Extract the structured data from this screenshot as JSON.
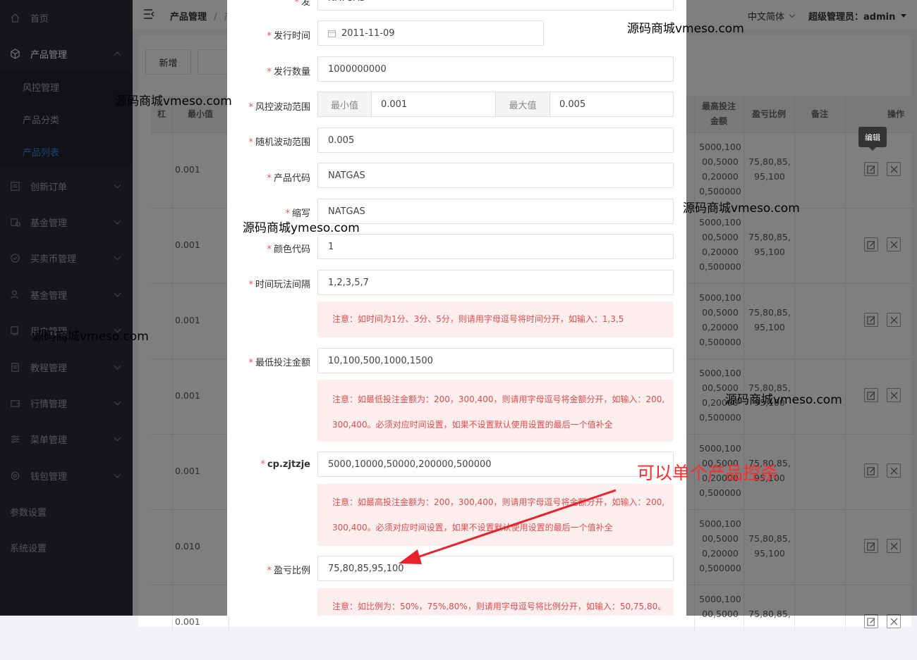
{
  "sidebar": {
    "items": [
      {
        "label": "首页",
        "icon": "home-icon"
      },
      {
        "label": "产品管理",
        "icon": "cube-icon"
      },
      {
        "label": "创新订单",
        "icon": "list-icon"
      },
      {
        "label": "基金管理",
        "icon": "coins-icon"
      },
      {
        "label": "买卖币管理",
        "icon": "check-circle-icon"
      },
      {
        "label": "基金管理",
        "icon": "user-icon"
      },
      {
        "label": "用户管理",
        "icon": "monitor-icon"
      },
      {
        "label": "教程管理",
        "icon": "doc-icon"
      },
      {
        "label": "行情管理",
        "icon": "wallet-icon"
      },
      {
        "label": "菜单管理",
        "icon": "sliders-icon"
      },
      {
        "label": "钱包管理",
        "icon": "gear-icon"
      },
      {
        "label": "参数设置",
        "icon": ""
      },
      {
        "label": "系统设置",
        "icon": ""
      }
    ],
    "submenu": [
      "风控管理",
      "产品分类",
      "产品列表"
    ]
  },
  "topbar": {
    "breadcrumb_1": "产品管理",
    "breadcrumb_sep": "/",
    "breadcrumb_2": "产",
    "language": "中文简体",
    "user": "超级管理员：admin"
  },
  "toolbar": {
    "add_label": "新增"
  },
  "table": {
    "headers": {
      "col1": "杠",
      "col2": "最小值",
      "max_bet": "最高投注金额",
      "profit_ratio": "盈亏比例",
      "remark": "备注",
      "ops": "操作"
    },
    "rows": [
      {
        "min": "0.001",
        "max_bet": "5000,100\n00,5000\n0,20000\n0,500000",
        "ratio": "75,80,85,\n95,100"
      },
      {
        "min": "0.001",
        "max_bet": "5000,100\n00,5000\n0,20000\n0,500000",
        "ratio": "75,80,85,\n95,100"
      },
      {
        "min": "0.001",
        "max_bet": "5000,100\n00,5000\n0,20000\n0,500000",
        "ratio": "75,80,85,\n95,100"
      },
      {
        "min": "0.001",
        "max_bet": "5000,100\n00,5000\n0,20000\n0,500000",
        "ratio": "75,80,85,\n95,100"
      },
      {
        "min": "0.001",
        "max_bet": "5000,100\n00,5000\n0,20000\n0,500000",
        "ratio": "75,80,85,\n95,100"
      },
      {
        "min": "0.010",
        "max_bet": "5000,100\n00,5000\n0,20000\n0,500000",
        "ratio": "75,80,85,\n95,100"
      },
      {
        "min": "0.001",
        "max_bet": "5000,100\n00,5000",
        "ratio": "75,80,85,"
      }
    ],
    "tooltip": "编辑"
  },
  "form": {
    "partial_top_label": "发",
    "partial_top_value": "NATGAS",
    "issue_time": {
      "label": "发行时间",
      "value": "2011-11-09"
    },
    "issue_qty": {
      "label": "发行数量",
      "value": "1000000000"
    },
    "risk_range": {
      "label": "风控波动范围",
      "min_addon": "最小值",
      "min_value": "0.001",
      "max_addon": "最大值",
      "max_value": "0.005"
    },
    "random_range": {
      "label": "随机波动范围",
      "value": "0.005"
    },
    "product_code": {
      "label": "产品代码",
      "value": "NATGAS"
    },
    "abbr": {
      "label": "缩写",
      "value": "NATGAS"
    },
    "color_code": {
      "label": "颜色代码",
      "value": "1"
    },
    "time_interval": {
      "label": "时间玩法间隔",
      "value": "1,2,3,5,7",
      "note": "注意：如时间为1分、3分、5分，则请用字母逗号将时间分开，如输入：1,3,5"
    },
    "min_bet": {
      "label": "最低投注金额",
      "value": "10,100,500,1000,1500",
      "note_1": "注意：如最低投注金额为：200，300,400，则请用字母逗号将金额分开，如输入：200,",
      "note_2": "300,400。必须对应时间设置，如果不设置默认使用设置的最后一个值补全"
    },
    "max_bet": {
      "label": "cp.zjtzje",
      "value": "5000,10000,50000,200000,500000",
      "note_1": "注意：如最高投注金额为：200，300,400，则请用字母逗号将金额分开，如输入：200,",
      "note_2": "300,400。必须对应时间设置，如果不设置默认使用设置的最后一个值补全"
    },
    "profit_ratio": {
      "label": "盈亏比例",
      "value": "75,80,85,95,100",
      "note": "注意：如比例为：50%，75%,80%，则请用字母逗号将比例分开，如输入：50,75,80。"
    }
  },
  "annotation": {
    "text": "可以单个产品控杀",
    "color": "#ff2a2a"
  },
  "watermark": "源码商城vmeso.com",
  "watermark_alt": "源码商城ymeso.com",
  "colors": {
    "accent": "#2d8cf0",
    "required": "#ff4d4f",
    "note_text": "#e24c4c",
    "note_bg": "#fdeeee",
    "sidebar_bg": "#2a2d33"
  }
}
